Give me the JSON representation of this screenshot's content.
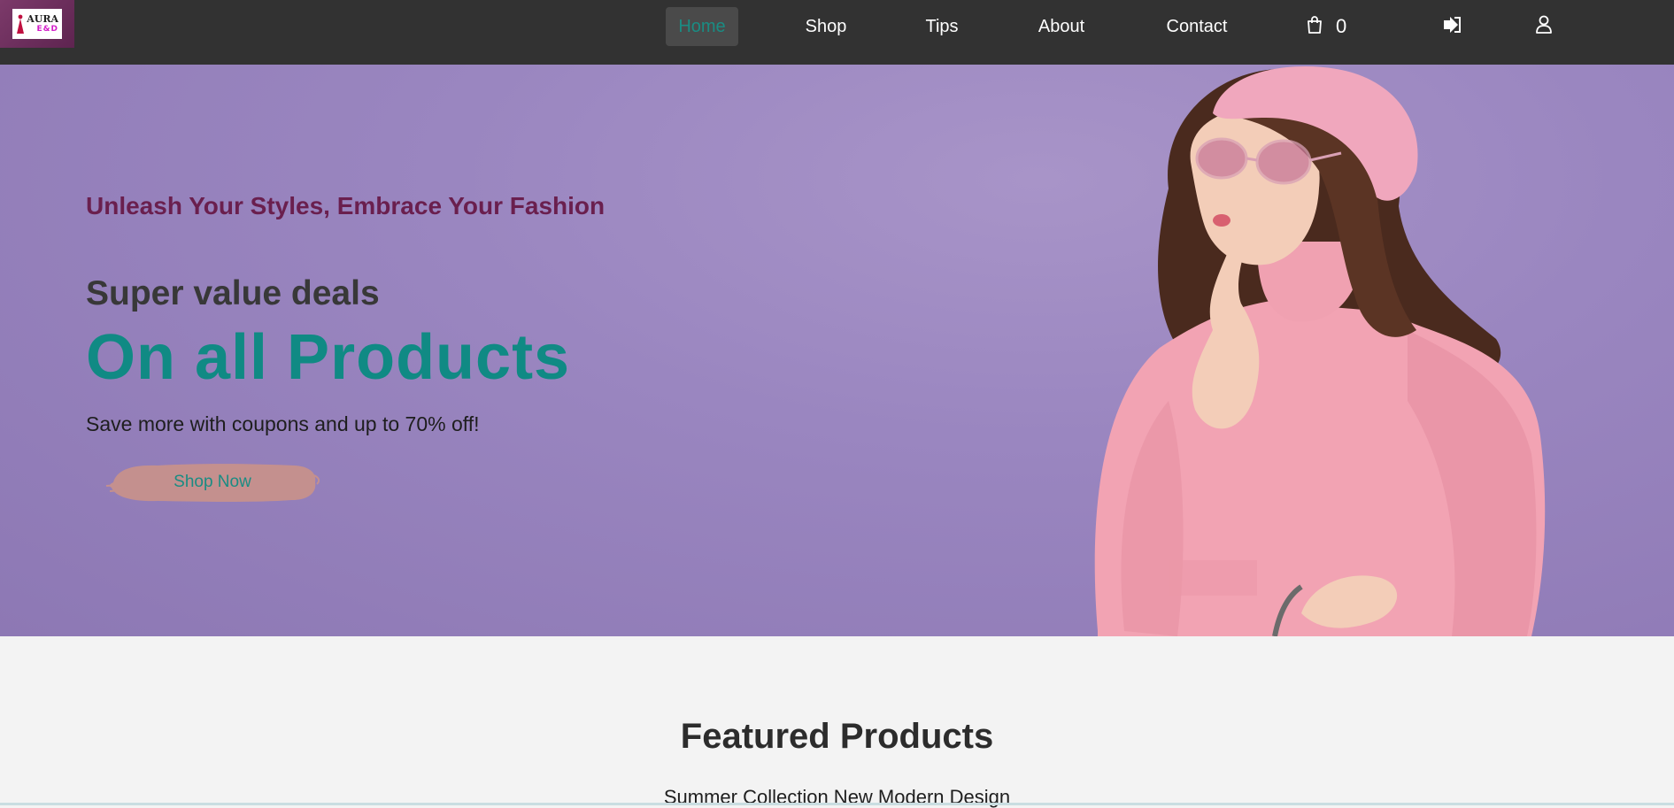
{
  "nav": {
    "items": [
      {
        "label": "Home",
        "active": true
      },
      {
        "label": "Shop",
        "active": false
      },
      {
        "label": "Tips",
        "active": false
      },
      {
        "label": "About",
        "active": false
      },
      {
        "label": "Contact",
        "active": false
      }
    ],
    "cart_count": "0",
    "icons": [
      "cart-icon",
      "logout-icon",
      "user-icon"
    ]
  },
  "logo": {
    "text_top": "AURA",
    "text_bottom": "E&D"
  },
  "hero": {
    "tagline": "Unleash Your Styles, Embrace Your Fashion",
    "sub_heading": "Super value deals",
    "main_heading": "On all Products",
    "text": "Save more with coupons and up to 70% off!",
    "cta_label": "Shop Now"
  },
  "featured": {
    "title": "Featured Products",
    "subtitle": "Summer Collection New Modern Design"
  },
  "colors": {
    "navbar": "#323232",
    "accent_teal": "#108a84",
    "tagline": "#6a1f4e",
    "hero_bg": "#9a86c0",
    "cta_brush": "#c4908e"
  }
}
